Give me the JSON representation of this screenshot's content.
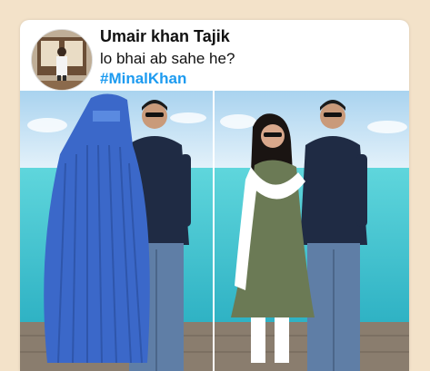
{
  "tweet": {
    "author_name": "Umair khan Tajik",
    "text": "lo bhai ab sahe he?",
    "hashtag": "#MinalKhan"
  },
  "icons": {
    "avatar": "profile-photo",
    "photo_left": "person-in-blue-burqa-with-man",
    "photo_right": "woman-in-green-dress-with-man"
  },
  "colors": {
    "background": "#f3e2c9",
    "hashtag": "#1d9bf0",
    "sea": "#3fc6cf",
    "burqa": "#3b68c9"
  }
}
